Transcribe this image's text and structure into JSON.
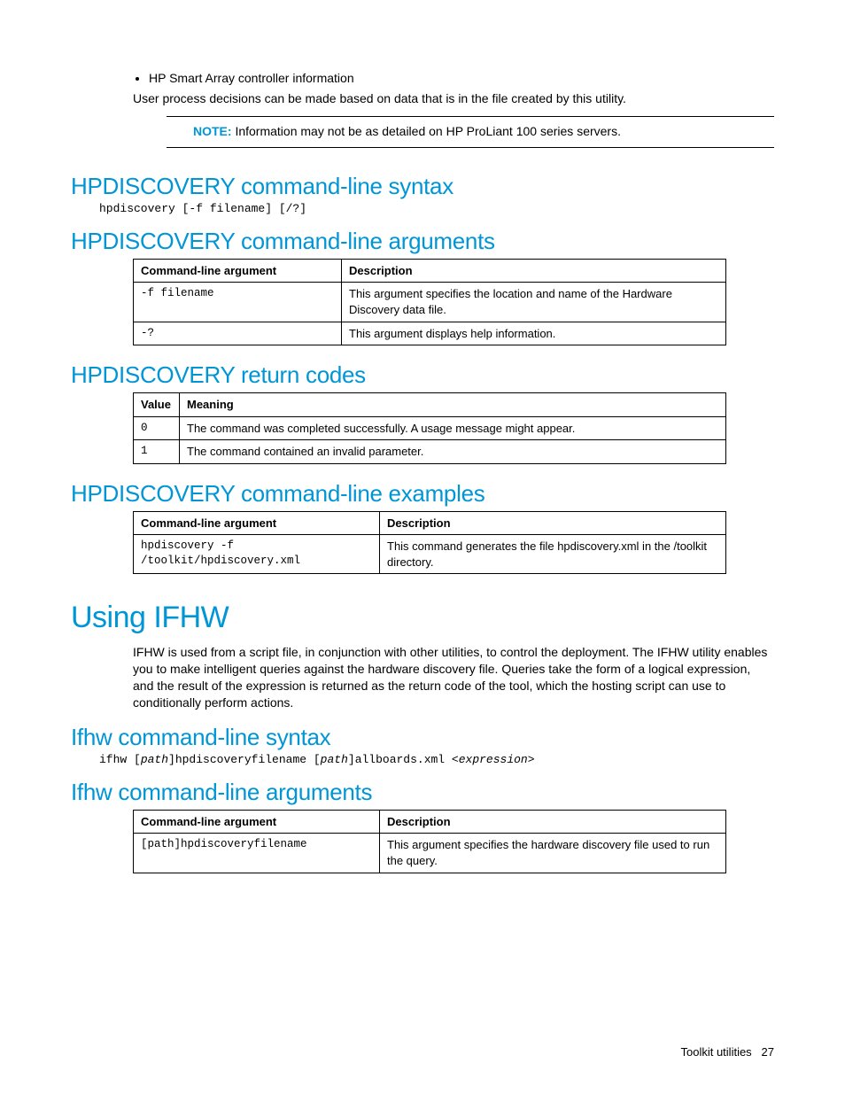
{
  "bullet1": "HP Smart Array controller information",
  "intro_para": "User process decisions can be made based on data that is in the file created by this utility.",
  "note_label": "NOTE:",
  "note_text": " Information may not be as detailed on HP ProLiant 100 series servers.",
  "sec1_title": "HPDISCOVERY command-line syntax",
  "sec1_code": "hpdiscovery [-f filename] [/?]",
  "sec2_title": "HPDISCOVERY command-line arguments",
  "t1_h1": "Command-line argument",
  "t1_h2": "Description",
  "t1_r1c1": "-f filename",
  "t1_r1c2": "This argument specifies the location and name of the Hardware Discovery data file.",
  "t1_r2c1": "-?",
  "t1_r2c2": "This argument displays help information.",
  "sec3_title": "HPDISCOVERY return codes",
  "t2_h1": "Value",
  "t2_h2": "Meaning",
  "t2_r1c1": "0",
  "t2_r1c2": "The command was completed successfully. A usage message might appear.",
  "t2_r2c1": "1",
  "t2_r2c2": "The command contained an invalid parameter.",
  "sec4_title": "HPDISCOVERY command-line examples",
  "t3_h1": "Command-line argument",
  "t3_h2": "Description",
  "t3_r1c1": "hpdiscovery -f /toolkit/hpdiscovery.xml",
  "t3_r1c2": "This command generates the file hpdiscovery.xml in the /toolkit directory.",
  "main2_title": "Using IFHW",
  "main2_para": "IFHW is used from a script file, in conjunction with other utilities, to control the deployment. The IFHW utility enables you to make intelligent queries against the hardware discovery file. Queries take the form of a logical expression, and the result of the expression is returned as the return code of the tool, which the hosting script can use to conditionally perform actions.",
  "sec5_title": "Ifhw command-line syntax",
  "sec5_code_p1": "ifhw [",
  "sec5_code_p2": "path",
  "sec5_code_p3": "]hpdiscoveryfilename [",
  "sec5_code_p4": "path",
  "sec5_code_p5": "]allboards.xml <",
  "sec5_code_p6": "expression",
  "sec5_code_p7": ">",
  "sec6_title": "Ifhw command-line arguments",
  "t4_h1": "Command-line argument",
  "t4_h2": "Description",
  "t4_r1c1": "[path]hpdiscoveryfilename",
  "t4_r1c2": "This argument specifies the hardware discovery file used to run the query.",
  "footer_label": "Toolkit utilities",
  "footer_page": "27"
}
